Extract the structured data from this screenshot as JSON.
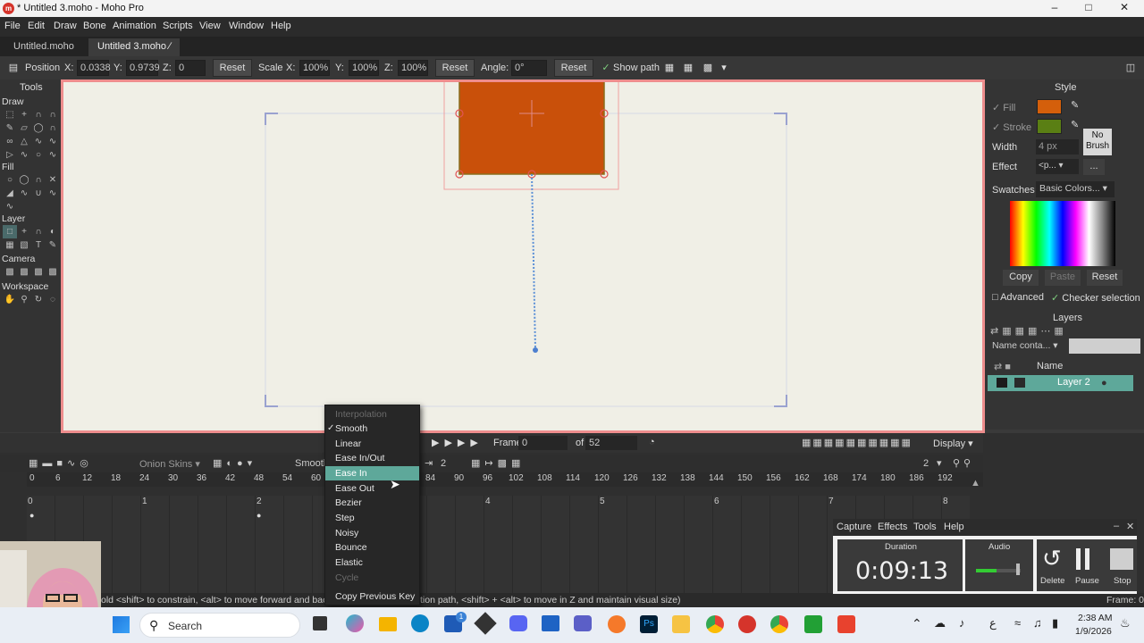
{
  "window": {
    "title": "* Untitled 3.moho - Moho Pro",
    "logo_text": "m"
  },
  "menubar": [
    "File",
    "Edit",
    "Draw",
    "Bone",
    "Animation",
    "Scripts",
    "View",
    "Window",
    "Help"
  ],
  "tabs": [
    {
      "label": "Untitled.moho"
    },
    {
      "label": "Untitled 3.moho",
      "modified_mark": "∕"
    }
  ],
  "options": {
    "position_label": "Position",
    "x_label": "X:",
    "x_value": "0.0338",
    "y_label": "Y:",
    "y_value": "0.9739",
    "z_label": "Z:",
    "z_value": "0",
    "reset1": "Reset",
    "scale_label": "Scale",
    "sx_label": "X:",
    "sx_value": "100%",
    "sy_label": "Y:",
    "sy_value": "100%",
    "sz_label": "Z:",
    "sz_value": "100%",
    "reset2": "Reset",
    "angle_label": "Angle:",
    "angle_value": "0°",
    "reset3": "Reset",
    "show_path_label": "Show path",
    "show_path_checked": true
  },
  "tools": {
    "title": "Tools",
    "sections": [
      "Draw",
      "Fill",
      "Layer",
      "Camera",
      "Workspace"
    ]
  },
  "style": {
    "title": "Style",
    "fill_label": "Fill",
    "fill_color": "#d45f0b",
    "stroke_label": "Stroke",
    "stroke_color": "#5a7f14",
    "width_label": "Width",
    "width_value": "4 px",
    "no_brush_label": "No Brush",
    "effect_label": "Effect",
    "effect_value": "<p...",
    "effect_btn": "...",
    "swatches_label": "Swatches",
    "swatches_value": "Basic Colors...",
    "copy": "Copy",
    "paste": "Paste",
    "reset": "Reset",
    "advanced_label": "Advanced",
    "checker_label": "Checker selection"
  },
  "layers": {
    "title": "Layers",
    "filter_value": "Name conta...",
    "name_header": "Name",
    "items": [
      {
        "name": "Layer 2"
      }
    ]
  },
  "playback": {
    "frame_label": "Frame",
    "frame_value": "0",
    "of_label": "of",
    "of_value": "52",
    "display_label": "Display"
  },
  "timeline": {
    "onion_label": "Onion Skins",
    "interp_value": "Smooth",
    "keys_value": "2",
    "zoom_value": "2",
    "ruler": [
      "0",
      "6",
      "12",
      "18",
      "24",
      "30",
      "36",
      "42",
      "48",
      "54",
      "60",
      "84",
      "90",
      "96",
      "102",
      "108",
      "114",
      "120",
      "126",
      "132",
      "138",
      "144",
      "150",
      "156",
      "162",
      "168",
      "174",
      "180",
      "186",
      "192"
    ],
    "seconds": [
      "0",
      "1",
      "2",
      "4",
      "5",
      "6",
      "7",
      "8"
    ]
  },
  "interp_menu": {
    "header": "Interpolation",
    "items": [
      {
        "label": "Smooth",
        "checked": true
      },
      {
        "label": "Linear"
      },
      {
        "label": "Ease In/Out"
      },
      {
        "label": "Ease In",
        "highlighted": true
      },
      {
        "label": "Ease Out"
      },
      {
        "label": "Bezier"
      },
      {
        "label": "Step"
      },
      {
        "label": "Noisy"
      },
      {
        "label": "Bounce"
      },
      {
        "label": "Elastic"
      },
      {
        "label": "Cycle",
        "disabled": true
      },
      {
        "label": "Copy Previous Key"
      }
    ]
  },
  "status": {
    "left_text": "old <shift> to constrain, <alt> to move forward and back",
    "mid_text": "tion path, <shift> + <alt> to move in Z and maintain visual size)",
    "frame_text": "Frame: 0"
  },
  "recorder": {
    "tabs": [
      "Capture",
      "Effects",
      "Tools",
      "Help"
    ],
    "duration_label": "Duration",
    "duration_value": "0:09:13",
    "audio_label": "Audio",
    "delete_label": "Delete",
    "pause_label": "Pause",
    "stop_label": "Stop",
    "audio_level": 0.45
  },
  "taskbar": {
    "search_placeholder": "Search",
    "time": "2:38 AM",
    "date": "1/9/2026",
    "lang": "ع",
    "badge": "1"
  }
}
